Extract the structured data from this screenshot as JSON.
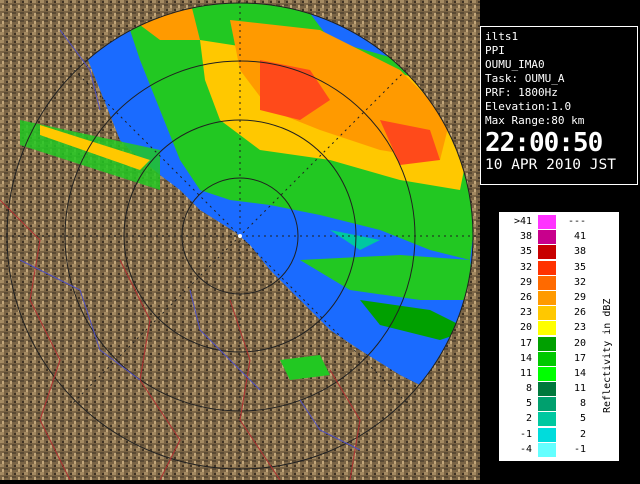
{
  "info": {
    "station": "ilts1",
    "mode": "PPI",
    "product": "OUMU_IMA0",
    "task": "Task: OUMU_A",
    "prf": "PRF: 1800Hz",
    "elevation": "Elevation:1.0",
    "max_range": "Max Range:80 km",
    "time": "22:00:50",
    "date": "10 APR 2010 JST"
  },
  "legend": {
    "unit_label": "Reflectivity in dBZ",
    "rows": [
      {
        "low": ">41",
        "high": "---",
        "color": "#ff33ff"
      },
      {
        "low": "38",
        "high": "41",
        "color": "#c8008c"
      },
      {
        "low": "35",
        "high": "38",
        "color": "#c80000"
      },
      {
        "low": "32",
        "high": "35",
        "color": "#ff3200"
      },
      {
        "low": "29",
        "high": "32",
        "color": "#ff6a00"
      },
      {
        "low": "26",
        "high": "29",
        "color": "#ff9a00"
      },
      {
        "low": "23",
        "high": "26",
        "color": "#ffc800"
      },
      {
        "low": "20",
        "high": "23",
        "color": "#ffff00"
      },
      {
        "low": "17",
        "high": "20",
        "color": "#00a000"
      },
      {
        "low": "14",
        "high": "17",
        "color": "#00c800"
      },
      {
        "low": "11",
        "high": "14",
        "color": "#00ff00"
      },
      {
        "low": "8",
        "high": "11",
        "color": "#00783c"
      },
      {
        "low": "5",
        "high": "8",
        "color": "#00a06e"
      },
      {
        "low": "2",
        "high": "5",
        "color": "#00c8a0"
      },
      {
        "low": "-1",
        "high": "2",
        "color": "#00dcdc"
      },
      {
        "low": "-4",
        "high": "-1",
        "color": "#64ffff"
      }
    ]
  },
  "map": {
    "ocean_color": "#0a64ff",
    "land_color": "#8b7355",
    "ring_color": "#222222"
  }
}
